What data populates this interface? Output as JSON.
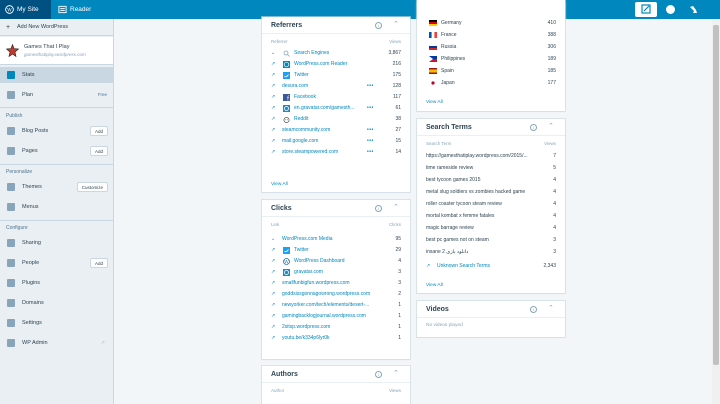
{
  "masterbar": {
    "my_site": "My Site",
    "reader": "Reader"
  },
  "sidebar": {
    "add_new": "Add New WordPress",
    "site_name": "Games That I Play",
    "site_url": "gamesthatiplay.wordpress.com",
    "items_top": [
      {
        "label": "Stats"
      },
      {
        "label": "Plan",
        "tag": "Free"
      }
    ],
    "sections": {
      "publish": "Publish",
      "personalize": "Personalize",
      "configure": "Configure"
    },
    "publish_items": [
      {
        "label": "Blog Posts",
        "action": "Add"
      },
      {
        "label": "Pages",
        "action": "Add"
      }
    ],
    "personalize_items": [
      {
        "label": "Themes",
        "action": "Customize"
      },
      {
        "label": "Menus"
      }
    ],
    "configure_items": [
      {
        "label": "Sharing"
      },
      {
        "label": "People",
        "action": "Add"
      },
      {
        "label": "Plugins"
      },
      {
        "label": "Domains"
      },
      {
        "label": "Settings"
      },
      {
        "label": "WP Admin"
      }
    ]
  },
  "referrers": {
    "title": "Referrers",
    "col_left": "Referrer",
    "col_right": "Views",
    "rows": [
      {
        "label": "Search Engines",
        "value": "3,867"
      },
      {
        "label": "WordPress.com Reader",
        "value": "216"
      },
      {
        "label": "Twitter",
        "value": "175"
      },
      {
        "label": "desura.com",
        "value": "128"
      },
      {
        "label": "Facebook",
        "value": "117"
      },
      {
        "label": "en.gravatar.com/gamesth...",
        "value": "61"
      },
      {
        "label": "Reddit",
        "value": "38"
      },
      {
        "label": "steamcommunity.com",
        "value": "27"
      },
      {
        "label": "mail.google.com",
        "value": "15"
      },
      {
        "label": "store.steampowered.com",
        "value": "14"
      }
    ],
    "view_all": "View All"
  },
  "clicks": {
    "title": "Clicks",
    "col_left": "Link",
    "col_right": "Clicks",
    "rows": [
      {
        "label": "WordPress.com Media",
        "value": "95"
      },
      {
        "label": "Twitter",
        "value": "29"
      },
      {
        "label": "WordPress Dashboard",
        "value": "4"
      },
      {
        "label": "gravatar.com",
        "value": "3"
      },
      {
        "label": "smallfunbigfun.wordpress.com",
        "value": "3"
      },
      {
        "label": "goddsissgonnagowrong.wordpress.com",
        "value": "2"
      },
      {
        "label": "newyorker.com/tech/elements/desert-...",
        "value": "1"
      },
      {
        "label": "gamingbacklogjournal.wordpress.com",
        "value": "1"
      },
      {
        "label": "2sitsp.wordpress.com",
        "value": "1"
      },
      {
        "label": "youtu.be/k334p6lyr0k",
        "value": "1"
      }
    ]
  },
  "authors": {
    "title": "Authors",
    "col_left": "Author",
    "col_right": "Views"
  },
  "countries": {
    "rows": [
      {
        "label": "Germany",
        "value": "410"
      },
      {
        "label": "France",
        "value": "388"
      },
      {
        "label": "Russia",
        "value": "306"
      },
      {
        "label": "Philippines",
        "value": "189"
      },
      {
        "label": "Spain",
        "value": "185"
      },
      {
        "label": "Japan",
        "value": "177"
      }
    ],
    "view_all": "View All"
  },
  "search_terms": {
    "title": "Search Terms",
    "col_left": "Search Term",
    "col_right": "Views",
    "rows": [
      {
        "label": "https://gamesthatiplay.wordpress.com/2015/...",
        "value": "7"
      },
      {
        "label": "time rameside review",
        "value": "5"
      },
      {
        "label": "best tycoon games 2015",
        "value": "4"
      },
      {
        "label": "metal slug soldiers vs zombies hacked game",
        "value": "4"
      },
      {
        "label": "roller coaster tycoon steam review",
        "value": "4"
      },
      {
        "label": "mortal kombat x femme fatales",
        "value": "4"
      },
      {
        "label": "magic barrage review",
        "value": "4"
      },
      {
        "label": "best pc games not on steam",
        "value": "3"
      },
      {
        "label": "insane 2 دانلود بازی",
        "value": "3"
      },
      {
        "label": "Unknown Search Terms",
        "value": "2,343"
      }
    ],
    "view_all": "View All"
  },
  "videos": {
    "title": "Videos",
    "empty": "No videos played"
  },
  "colors": {
    "brand": "#0087be",
    "masterbar_active": "#005082"
  }
}
